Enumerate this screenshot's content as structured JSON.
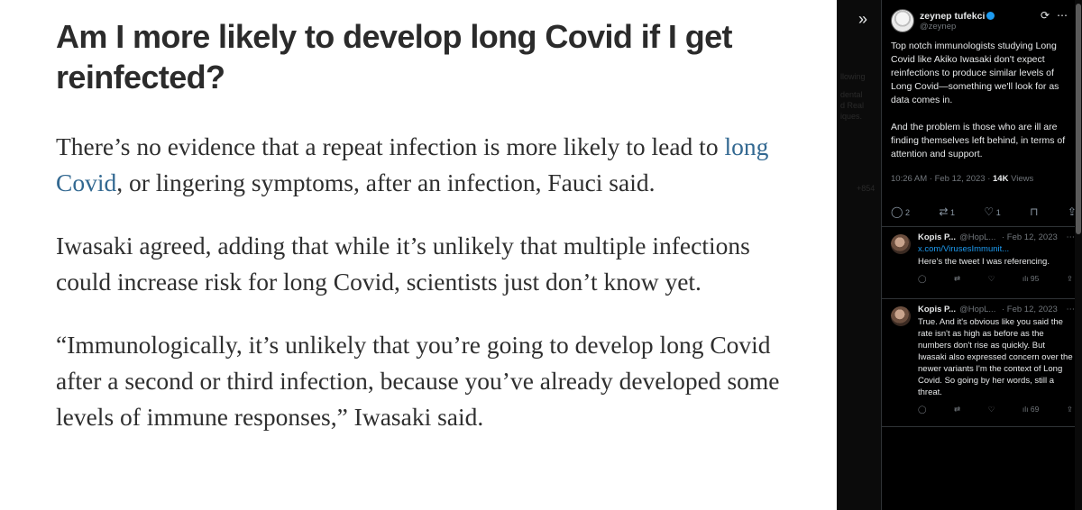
{
  "article": {
    "headline": "Am I more likely to develop long Covid if I get reinfected?",
    "p1_before_link": "There’s no evidence that a repeat infection is more likely to lead to ",
    "p1_link": "long Covid",
    "p1_after_link": ", or lingering symptoms, after an infection, Fauci said.",
    "p2": "Iwasaki agreed, adding that while it’s unlikely that multiple infections could increase risk for long Covid, scientists just don’t know yet.",
    "p3": "“Immunologically, it’s unlikely that you’re going to develop long Covid after a second or third infection, because you’ve already developed some levels of immune responses,” Iwasaki said.",
    "link_color": "#326891"
  },
  "background_strip": {
    "ghost_lines": [
      "llowing",
      "dental",
      "d Real",
      "iques."
    ],
    "ghost_badge": "+854"
  },
  "collapse_icon": "double-chevron-right-icon",
  "main_tweet": {
    "display_name": "zeynep tufekci",
    "handle": "@zeynep",
    "text": "Top notch immunologists studying Long Covid like Akiko Iwasaki don't expect reinfections to produce similar levels of Long Covid—something we'll look for as data comes in.\n\nAnd the problem is those who are ill are finding themselves left behind, in terms of attention and support.",
    "timestamp": "10:26 AM · Feb 12, 2023 · ",
    "views_count": "14K",
    "views_label": " Views",
    "replies": "2",
    "retweets": "1",
    "likes": "1",
    "verified_color": "#1d9bf0"
  },
  "replies": [
    {
      "name": "Kopis P...",
      "handle": "@HopL...",
      "date": "· Feb 12, 2023",
      "link": "x.com/VirusesImmunit...",
      "text": "Here's the tweet I was referencing.",
      "views": "95"
    },
    {
      "name": "Kopis P...",
      "handle": "@HopL...",
      "date": "· Feb 12, 2023",
      "text": "True. And it's obvious like you said the rate isn't as high as before as the numbers don't rise as quickly. But Iwasaki also expressed concern over the newer variants I'm the context of Long Covid. So going by her words, still a threat.",
      "views": "69"
    }
  ]
}
